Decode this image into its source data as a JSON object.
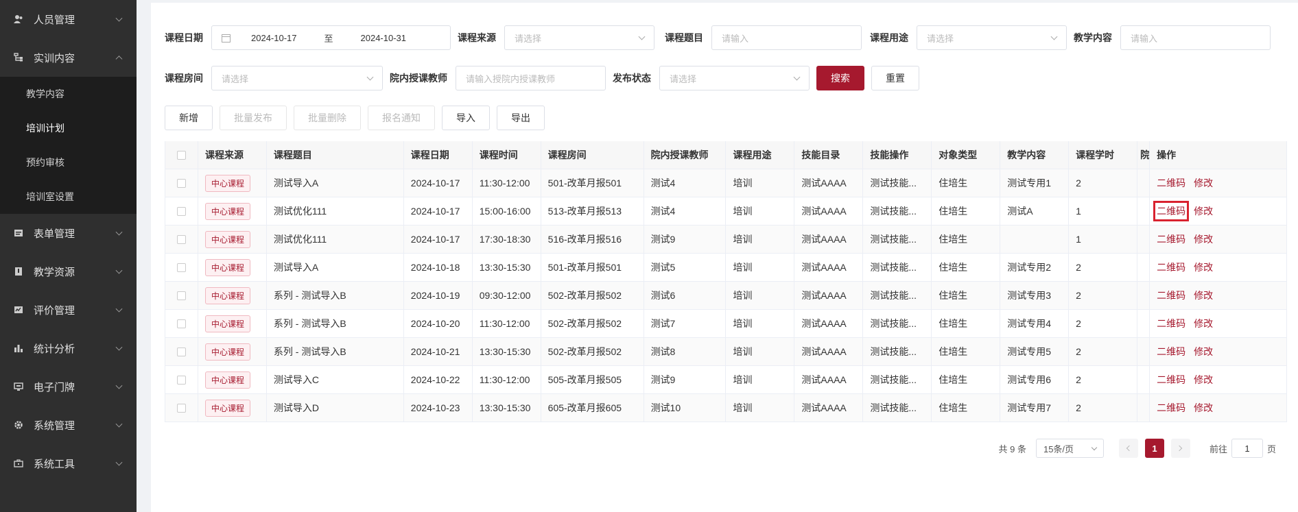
{
  "sidebar": {
    "items": [
      {
        "label": "人员管理",
        "icon": "users-icon",
        "expanded": false
      },
      {
        "label": "实训内容",
        "icon": "tree-icon",
        "expanded": true,
        "children": [
          "教学内容",
          "培训计划",
          "预约审核",
          "培训室设置"
        ],
        "active_child": "培训计划"
      },
      {
        "label": "表单管理",
        "icon": "form-icon",
        "expanded": false
      },
      {
        "label": "教学资源",
        "icon": "resource-icon",
        "expanded": false
      },
      {
        "label": "评价管理",
        "icon": "evaluation-icon",
        "expanded": false
      },
      {
        "label": "统计分析",
        "icon": "bar-chart-icon",
        "expanded": false
      },
      {
        "label": "电子门牌",
        "icon": "monitor-icon",
        "expanded": false
      },
      {
        "label": "系统管理",
        "icon": "gear-icon",
        "expanded": false
      },
      {
        "label": "系统工具",
        "icon": "toolbox-icon",
        "expanded": false
      }
    ]
  },
  "filters": {
    "course_date_label": "课程日期",
    "date_start": "2024-10-17",
    "date_sep": "至",
    "date_end": "2024-10-31",
    "course_source_label": "课程来源",
    "course_source_placeholder": "请选择",
    "course_title_label": "课程题目",
    "course_title_placeholder": "请输入",
    "course_purpose_label": "课程用途",
    "course_purpose_placeholder": "请选择",
    "teaching_content_label": "教学内容",
    "teaching_content_placeholder": "请输入",
    "course_room_label": "课程房间",
    "course_room_placeholder": "请选择",
    "teacher_label": "院内授课教师",
    "teacher_placeholder": "请输入授院内授课教师",
    "publish_status_label": "发布状态",
    "publish_status_placeholder": "请选择",
    "search_label": "搜索",
    "reset_label": "重置"
  },
  "toolbar": {
    "add": "新增",
    "batch_publish": "批量发布",
    "batch_delete": "批量删除",
    "signup_notice": "报名通知",
    "import": "导入",
    "export": "导出"
  },
  "table": {
    "headers": [
      "课程来源",
      "课程题目",
      "课程日期",
      "课程时间",
      "课程房间",
      "院内授课教师",
      "课程用途",
      "技能目录",
      "技能操作",
      "对象类型",
      "教学内容",
      "课程学时",
      "院",
      "操作"
    ],
    "rows": [
      [
        "中心课程",
        "测试导入A",
        "2024-10-17",
        "11:30-12:00",
        "501-改革月报501",
        "测试4",
        "培训",
        "测试AAAA",
        "测试技能...",
        "住培生",
        "测试专用1",
        "2"
      ],
      [
        "中心课程",
        "测试优化111",
        "2024-10-17",
        "15:00-16:00",
        "513-改革月报513",
        "测试4",
        "培训",
        "测试AAAA",
        "测试技能...",
        "住培生",
        "测试A",
        "1"
      ],
      [
        "中心课程",
        "测试优化111",
        "2024-10-17",
        "17:30-18:30",
        "516-改革月报516",
        "测试9",
        "培训",
        "测试AAAA",
        "测试技能...",
        "住培生",
        "",
        "1"
      ],
      [
        "中心课程",
        "测试导入A",
        "2024-10-18",
        "13:30-15:30",
        "501-改革月报501",
        "测试5",
        "培训",
        "测试AAAA",
        "测试技能...",
        "住培生",
        "测试专用2",
        "2"
      ],
      [
        "中心课程",
        "系列 - 测试导入B",
        "2024-10-19",
        "09:30-12:00",
        "502-改革月报502",
        "测试6",
        "培训",
        "测试AAAA",
        "测试技能...",
        "住培生",
        "测试专用3",
        "2"
      ],
      [
        "中心课程",
        "系列 - 测试导入B",
        "2024-10-20",
        "11:30-12:00",
        "502-改革月报502",
        "测试7",
        "培训",
        "测试AAAA",
        "测试技能...",
        "住培生",
        "测试专用4",
        "2"
      ],
      [
        "中心课程",
        "系列 - 测试导入B",
        "2024-10-21",
        "13:30-15:30",
        "502-改革月报502",
        "测试8",
        "培训",
        "测试AAAA",
        "测试技能...",
        "住培生",
        "测试专用5",
        "2"
      ],
      [
        "中心课程",
        "测试导入C",
        "2024-10-22",
        "11:30-12:00",
        "505-改革月报505",
        "测试9",
        "培训",
        "测试AAAA",
        "测试技能...",
        "住培生",
        "测试专用6",
        "2"
      ],
      [
        "中心课程",
        "测试导入D",
        "2024-10-23",
        "13:30-15:30",
        "605-改革月报605",
        "测试10",
        "培训",
        "测试AAAA",
        "测试技能...",
        "住培生",
        "测试专用7",
        "2"
      ]
    ],
    "action_qr": "二维码",
    "action_edit": "修改",
    "highlighted_row": 1
  },
  "pagination": {
    "total": "共 9 条",
    "page_size": "15条/页",
    "current_page": "1",
    "goto_label": "前往",
    "goto_value": "1",
    "page_suffix": "页"
  },
  "colors": {
    "brand": "#a6192e",
    "sidebar_bg": "#2f2f2f",
    "highlight": "#d9222f"
  }
}
